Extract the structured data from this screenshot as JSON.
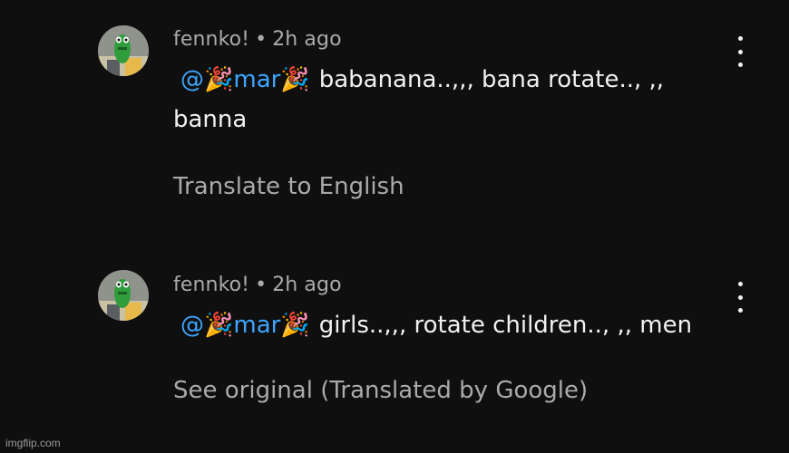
{
  "comments": [
    {
      "author": "fennko!",
      "separator": "•",
      "time": "2h ago",
      "mention": "@🎉mar🎉",
      "text": "babanana..,,, bana rotate.., ,, banna",
      "action": "Translate to English",
      "avatar_icon": "green-cartoon-avatar-icon",
      "menu_icon": "more-vert-icon"
    },
    {
      "author": "fennko!",
      "separator": "•",
      "time": "2h ago",
      "mention": "@🎉mar🎉",
      "text": "girls..,,, rotate children.., ,, men",
      "action": "See original (Translated by Google)",
      "avatar_icon": "green-cartoon-avatar-icon",
      "menu_icon": "more-vert-icon"
    }
  ],
  "watermark": "imgflip.com",
  "colors": {
    "background": "#0f0f0f",
    "text_primary": "#f1f1f1",
    "text_secondary": "#aaaaaa",
    "mention": "#3ea6ff"
  }
}
